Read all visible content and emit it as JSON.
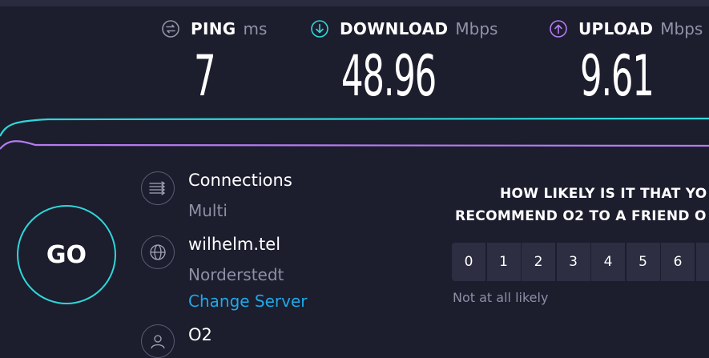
{
  "metrics": {
    "ping": {
      "label": "PING",
      "unit": "ms",
      "value": "7",
      "icon": "ping-icon"
    },
    "download": {
      "label": "DOWNLOAD",
      "unit": "Mbps",
      "value": "48.96",
      "icon": "download-arrow-icon",
      "color": "#2fd7d9"
    },
    "upload": {
      "label": "UPLOAD",
      "unit": "Mbps",
      "value": "9.61",
      "icon": "upload-arrow-icon",
      "color": "#b57bf0"
    }
  },
  "go_button": {
    "label": "GO",
    "color": "#2fd7d9"
  },
  "info": {
    "connections": {
      "title": "Connections",
      "value": "Multi",
      "icon": "connections-icon"
    },
    "server": {
      "title": "wilhelm.tel",
      "location": "Norderstedt",
      "change_link": "Change Server",
      "icon": "globe-icon"
    },
    "provider": {
      "title": "O2",
      "icon": "user-icon"
    }
  },
  "survey": {
    "question_line1": "HOW LIKELY IS IT THAT YO",
    "question_line2": "RECOMMEND O2 TO A FRIEND O",
    "scale": [
      "0",
      "1",
      "2",
      "3",
      "4",
      "5",
      "6"
    ],
    "low_label": "Not at all likely"
  },
  "colors": {
    "background": "#1c1d2d",
    "accent_download": "#2fd7d9",
    "accent_upload": "#b57bf0",
    "link": "#1fa8e8"
  }
}
